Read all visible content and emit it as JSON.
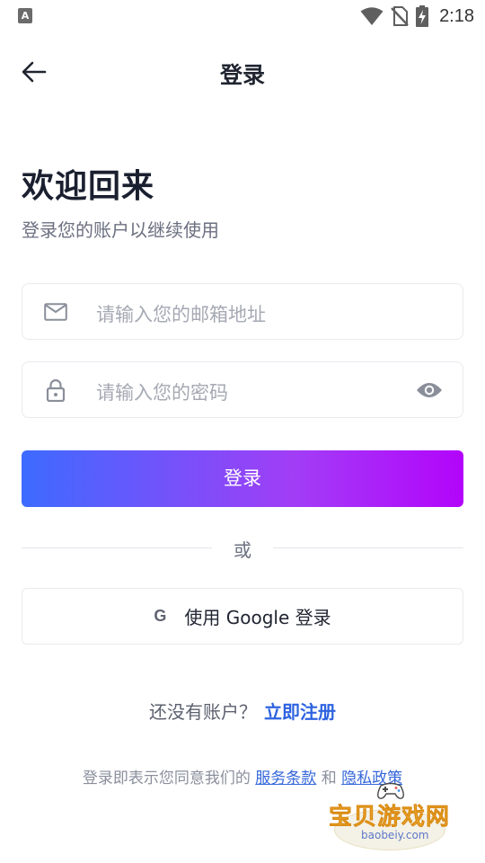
{
  "status_bar": {
    "notification_glyph": "A",
    "time": "2:18",
    "icons": [
      "wifi-icon",
      "no-sim-icon",
      "battery-charging-icon"
    ]
  },
  "app_bar": {
    "title": "登录",
    "back_icon": "arrow-left-icon"
  },
  "heading": {
    "title": "欢迎回来",
    "subtitle": "登录您的账户以继续使用"
  },
  "form": {
    "email": {
      "placeholder": "请输入您的邮箱地址",
      "value": "",
      "icon": "mail-icon"
    },
    "password": {
      "placeholder": "请输入您的密码",
      "value": "",
      "icon": "lock-icon",
      "toggle_icon": "eye-icon"
    },
    "login_label": "登录"
  },
  "divider": {
    "text": "或"
  },
  "social": {
    "google_icon_text": "G",
    "google_label": "使用 Google 登录"
  },
  "register": {
    "prompt": "还没有账户？",
    "link": "立即注册"
  },
  "terms": {
    "prefix": "登录即表示您同意我们的",
    "service_link": "服务条款",
    "conjunction": "和",
    "privacy_link": "隐私政策"
  },
  "watermark": {
    "text": "宝贝游戏网",
    "url": "baobeiy.com"
  },
  "colors": {
    "accent": "#2e63e0",
    "gradient_start": "#3d6bff",
    "gradient_end": "#b304fb"
  }
}
